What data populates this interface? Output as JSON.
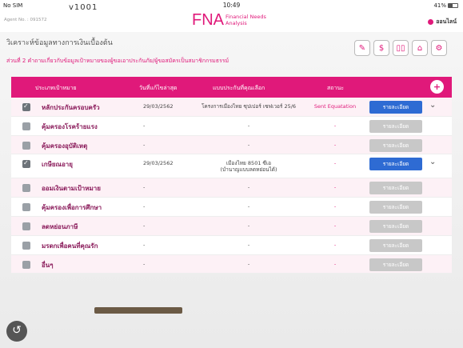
{
  "statusbar": {
    "carrier": "No SIM",
    "time": "10:49",
    "battery": "41%"
  },
  "app": {
    "version": "v1001",
    "agent_label": "Agent No. : 091572",
    "logo": "FNA",
    "logo_sub1": "Financial Needs",
    "logo_sub2": "Analysis",
    "online_label": "ออนไลน์"
  },
  "page": {
    "title": "วิเคราะห์ข้อมูลทางการเงินเบื้องต้น",
    "subtitle": "ส่วนที่ 2 คำถามเกี่ยวกับข้อมูลเป้าหมายของผู้ขอเอาประกันภัย/ผู้ขอสมัครเป็นสมาชิกกรมธรรม์"
  },
  "toolbar": {
    "icons": [
      "edit-icon",
      "money-icon",
      "compare-icon",
      "home-icon",
      "settings-icon"
    ]
  },
  "table": {
    "headers": {
      "goal": "ประเภทเป้าหมาย",
      "date": "วันที่แก้ไขล่าสุด",
      "plan": "แบบประกันที่คุณเลือก",
      "status": "สถานะ"
    },
    "add_label": "+",
    "rows": [
      {
        "checked": true,
        "goal": "หลักประกันครอบครัว",
        "date": "29/03/2562",
        "plan": "โครงการเมืองไทย ซุปเปอร์ เซฟเวอร์ 25/6",
        "plan2": "",
        "status": "Sent Equatation",
        "detail": "รายละเอียด",
        "active": true,
        "chev": "⌄"
      },
      {
        "checked": false,
        "goal": "คุ้มครองโรคร้ายแรง",
        "date": "-",
        "plan": "-",
        "plan2": "",
        "status": "-",
        "detail": "รายละเอียด",
        "active": false,
        "chev": ""
      },
      {
        "checked": false,
        "goal": "คุ้มครองอุบัติเหตุ",
        "date": "-",
        "plan": "-",
        "plan2": "",
        "status": "-",
        "detail": "รายละเอียด",
        "active": false,
        "chev": ""
      },
      {
        "checked": true,
        "goal": "เกษียณอายุ",
        "date": "29/03/2562",
        "plan": "เมืองไทย 8501 ซีเอ",
        "plan2": "(บำนาญแบบลดหย่อนได้)",
        "status": "-",
        "detail": "รายละเอียด",
        "active": true,
        "chev": "⌄"
      },
      {
        "checked": false,
        "goal": "ออมเงินตามเป้าหมาย",
        "date": "-",
        "plan": "-",
        "plan2": "",
        "status": "-",
        "detail": "รายละเอียด",
        "active": false,
        "chev": ""
      },
      {
        "checked": false,
        "goal": "คุ้มครองเพื่อการศึกษา",
        "date": "-",
        "plan": "-",
        "plan2": "",
        "status": "-",
        "detail": "รายละเอียด",
        "active": false,
        "chev": ""
      },
      {
        "checked": false,
        "goal": "ลดหย่อนภาษี",
        "date": "-",
        "plan": "-",
        "plan2": "",
        "status": "-",
        "detail": "รายละเอียด",
        "active": false,
        "chev": ""
      },
      {
        "checked": false,
        "goal": "มรดกเพื่อคนที่คุณรัก",
        "date": "-",
        "plan": "-",
        "plan2": "",
        "status": "-",
        "detail": "รายละเอียด",
        "active": false,
        "chev": ""
      },
      {
        "checked": false,
        "goal": "อื่นๆ",
        "date": "-",
        "plan": "-",
        "plan2": "",
        "status": "-",
        "detail": "รายละเอียด",
        "active": false,
        "chev": ""
      }
    ]
  },
  "colors": {
    "brand": "#e0197a",
    "active_button": "#2e6bd3"
  }
}
